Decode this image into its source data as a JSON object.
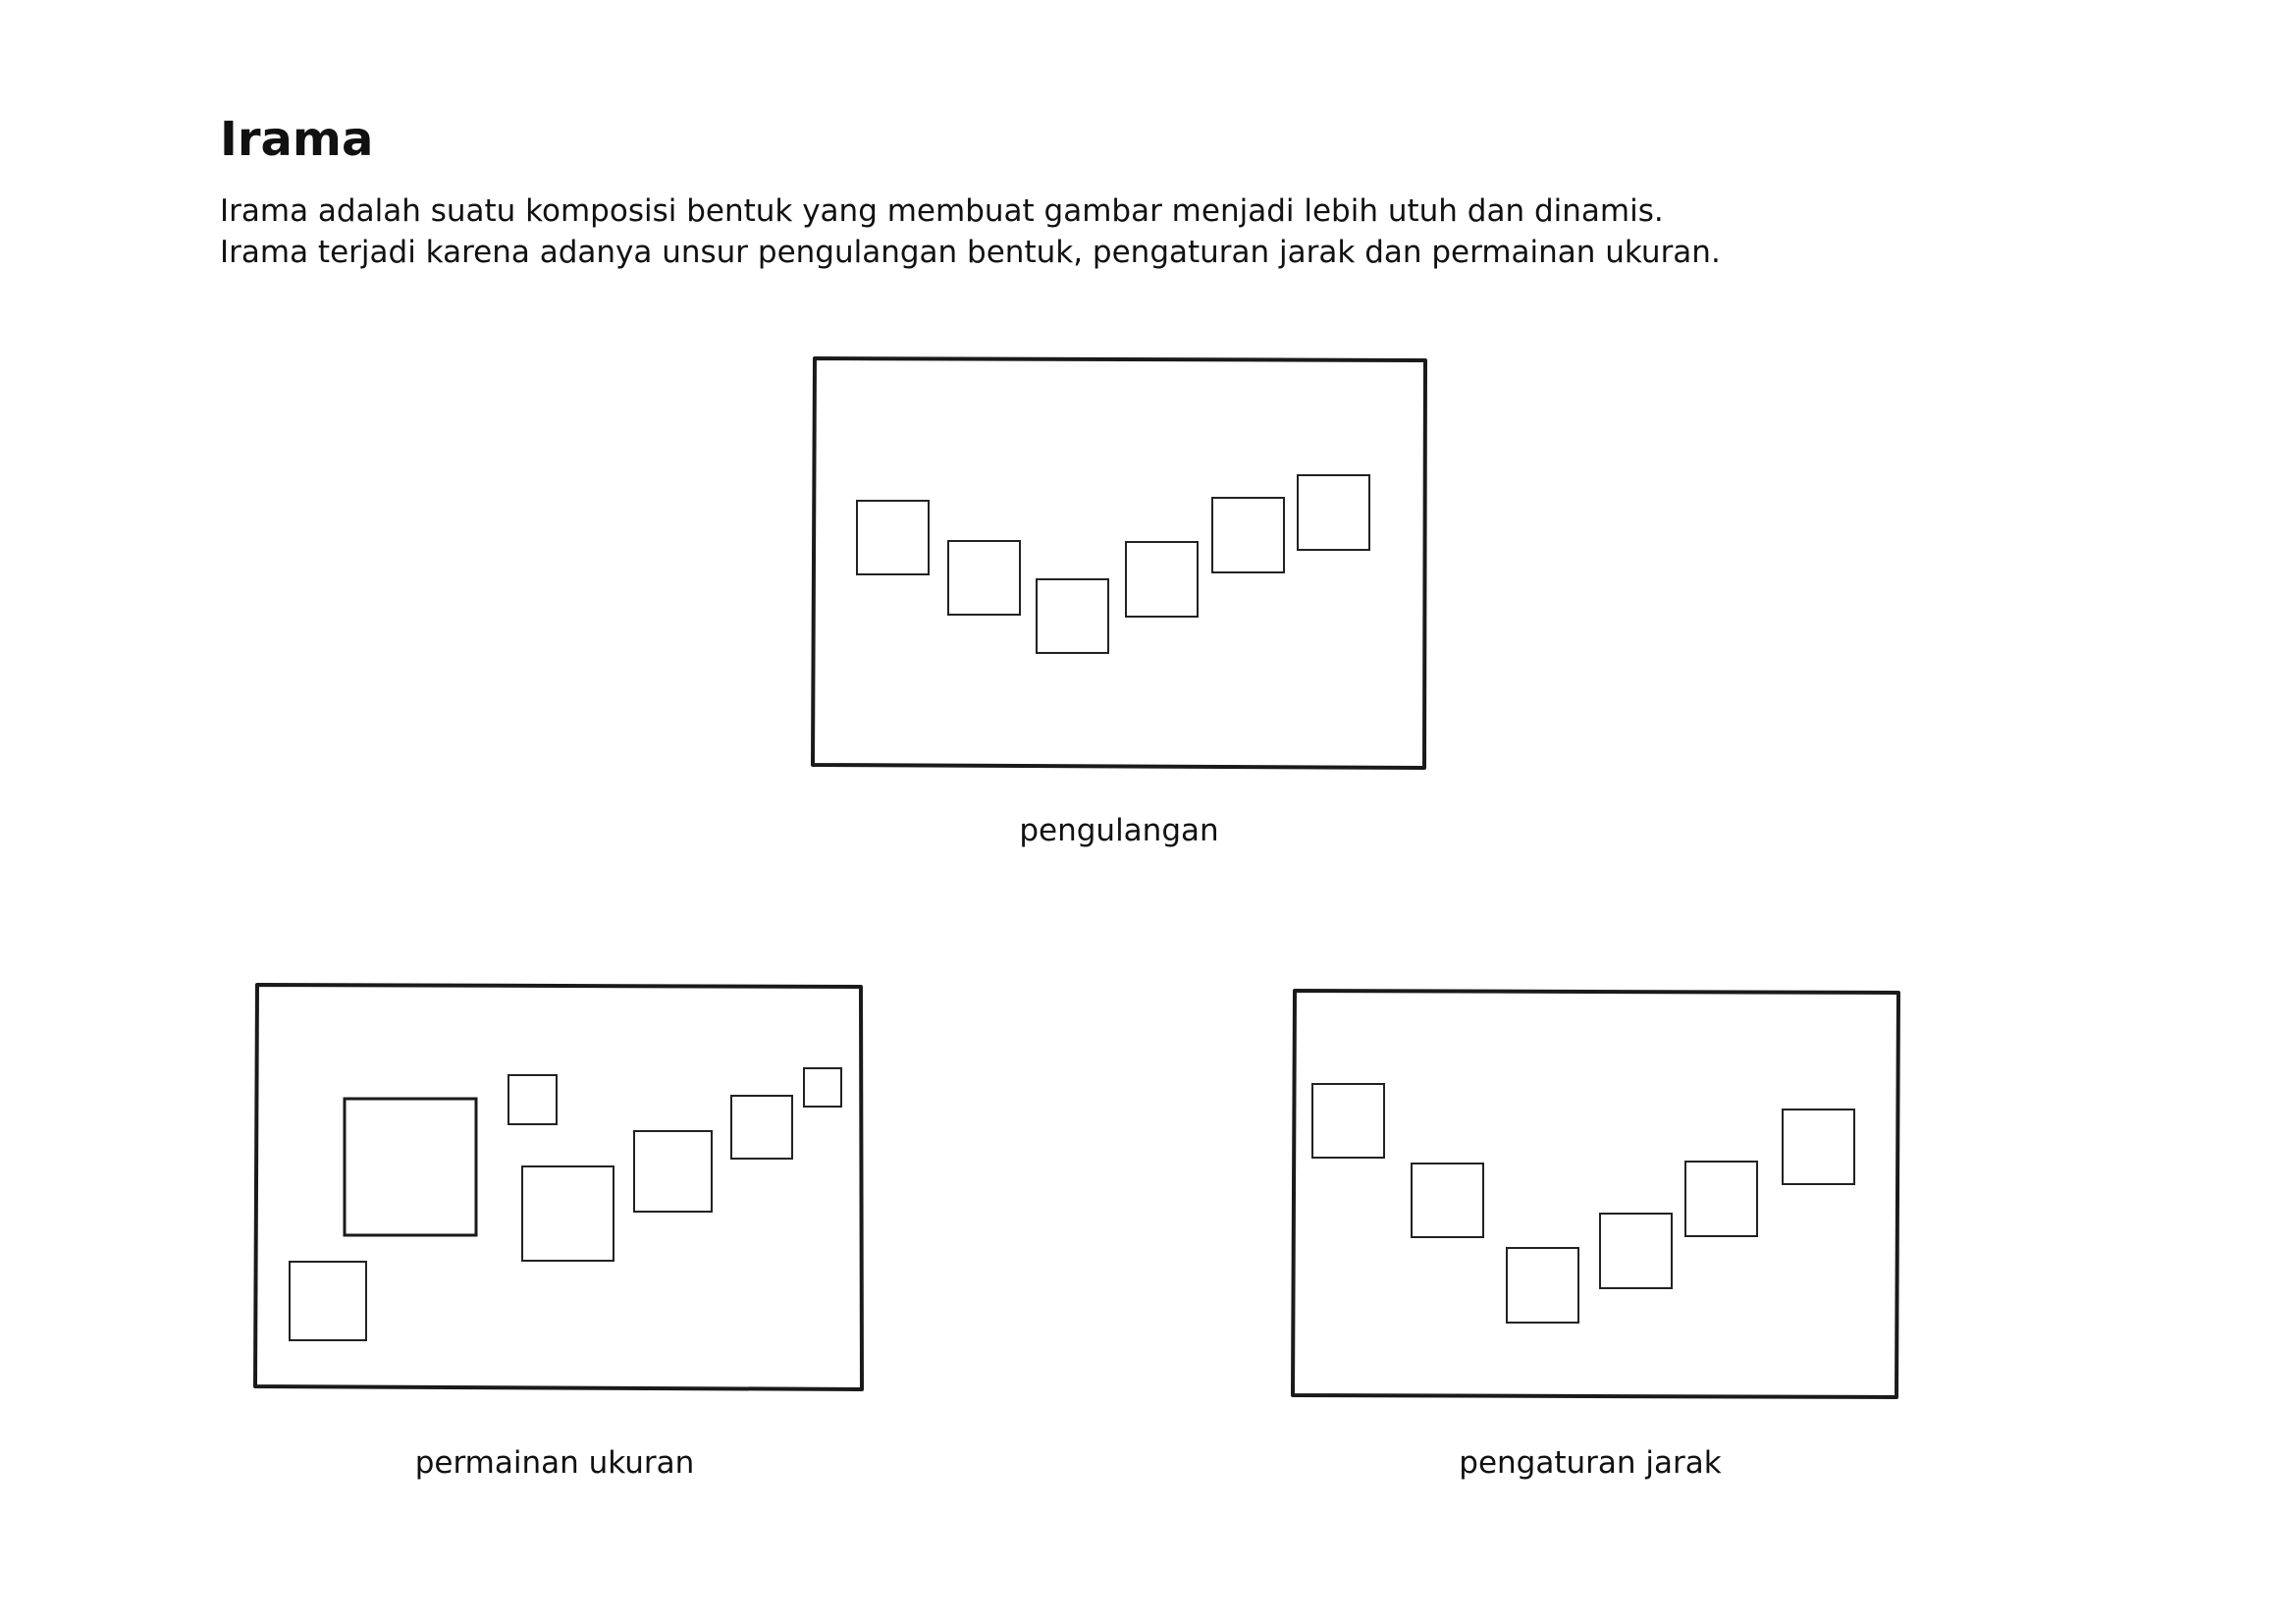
{
  "header": {
    "title": "Irama",
    "description": [
      "Irama adalah suatu komposisi bentuk yang membuat gambar menjadi lebih utuh dan dinamis.",
      "Irama terjadi karena adanya unsur pengulangan bentuk, pengaturan jarak dan permainan ukuran."
    ]
  },
  "figures": [
    {
      "caption": "pengulangan"
    },
    {
      "caption": "permainan ukuran"
    },
    {
      "caption": "pengaturan jarak"
    }
  ]
}
